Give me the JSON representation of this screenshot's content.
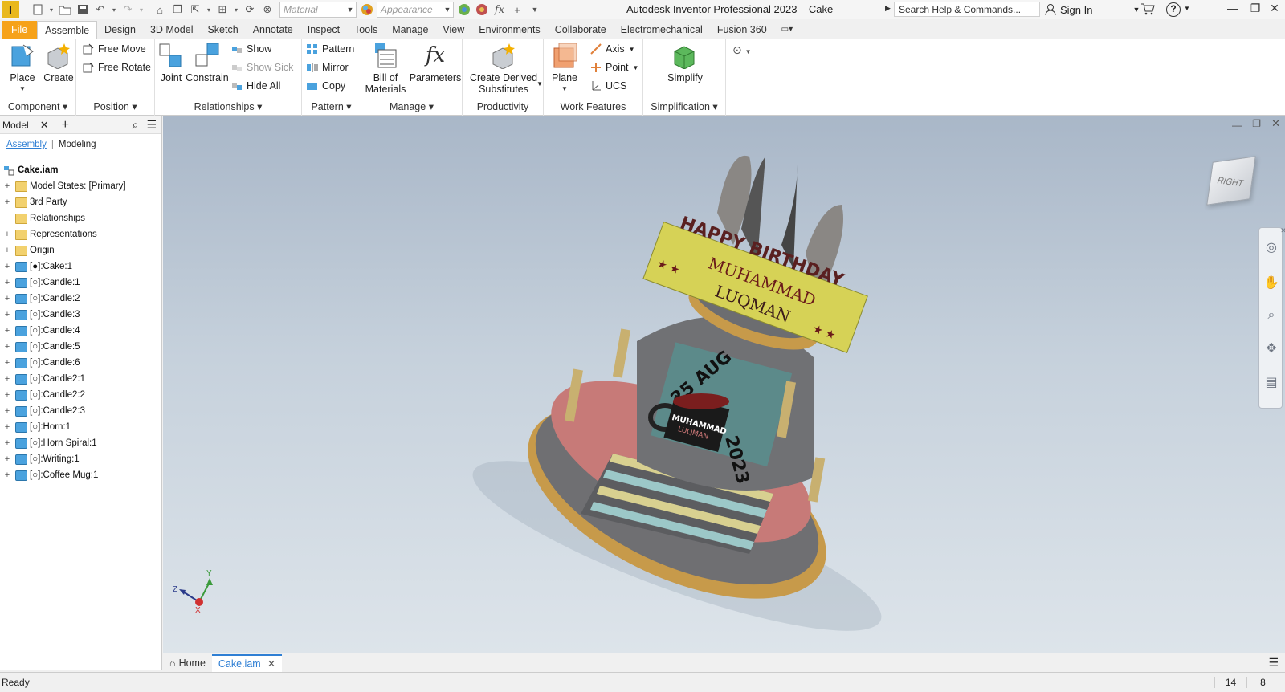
{
  "title_bar": {
    "app_title": "Autodesk Inventor Professional 2023",
    "document_name": "Cake",
    "material_placeholder": "Material",
    "appearance_placeholder": "Appearance",
    "search_placeholder": "Search Help & Commands...",
    "sign_in": "Sign In",
    "logo_letter": "I",
    "fx": "fx"
  },
  "tabs": [
    "File",
    "Assemble",
    "Design",
    "3D Model",
    "Sketch",
    "Annotate",
    "Inspect",
    "Tools",
    "Manage",
    "View",
    "Environments",
    "Collaborate",
    "Electromechanical",
    "Fusion 360"
  ],
  "active_tab": "Assemble",
  "ribbon": {
    "component": {
      "title": "Component",
      "place": "Place",
      "create": "Create"
    },
    "position": {
      "title": "Position",
      "free_move": "Free Move",
      "free_rotate": "Free Rotate"
    },
    "relationships": {
      "title": "Relationships",
      "joint": "Joint",
      "constrain": "Constrain",
      "show": "Show",
      "show_sick": "Show Sick",
      "hide_all": "Hide All"
    },
    "pattern": {
      "title": "Pattern",
      "pattern": "Pattern",
      "mirror": "Mirror",
      "copy": "Copy"
    },
    "manage": {
      "title": "Manage",
      "bom_line1": "Bill of",
      "bom_line2": "Materials",
      "parameters": "Parameters",
      "fx": "fx"
    },
    "productivity": {
      "title": "Productivity",
      "cds_line1": "Create Derived",
      "cds_line2": "Substitutes"
    },
    "work_features": {
      "title": "Work Features",
      "plane": "Plane",
      "axis": "Axis",
      "point": "Point",
      "ucs": "UCS"
    },
    "simplification": {
      "title": "Simplification",
      "simplify": "Simplify"
    }
  },
  "browser": {
    "title": "Model",
    "sub_assembly": "Assembly",
    "sub_modeling": "Modeling",
    "root": "Cake.iam",
    "nodes": [
      {
        "label": "Model States: [Primary]",
        "icon": "folder-icon",
        "expand": true
      },
      {
        "label": "3rd Party",
        "icon": "third-party-icon",
        "expand": true
      },
      {
        "label": "Relationships",
        "icon": "folder-icon",
        "expand": false
      },
      {
        "label": "Representations",
        "icon": "representations-icon",
        "expand": true
      },
      {
        "label": "Origin",
        "icon": "folder-icon",
        "expand": true
      },
      {
        "label": "[●]:Cake:1",
        "icon": "part-icon",
        "expand": true
      },
      {
        "label": "[○]:Candle:1",
        "icon": "part-icon",
        "expand": true
      },
      {
        "label": "[○]:Candle:2",
        "icon": "part-icon",
        "expand": true
      },
      {
        "label": "[○]:Candle:3",
        "icon": "part-icon",
        "expand": true
      },
      {
        "label": "[○]:Candle:4",
        "icon": "part-icon",
        "expand": true
      },
      {
        "label": "[○]:Candle:5",
        "icon": "part-icon",
        "expand": true
      },
      {
        "label": "[○]:Candle:6",
        "icon": "part-icon",
        "expand": true
      },
      {
        "label": "[○]:Candle2:1",
        "icon": "part-icon",
        "expand": true
      },
      {
        "label": "[○]:Candle2:2",
        "icon": "part-icon",
        "expand": true
      },
      {
        "label": "[○]:Candle2:3",
        "icon": "part-icon",
        "expand": true
      },
      {
        "label": "[○]:Horn:1",
        "icon": "part-icon",
        "expand": true
      },
      {
        "label": "[○]:Horn Spiral:1",
        "icon": "part-icon",
        "expand": true
      },
      {
        "label": "[○]:Writing:1",
        "icon": "part-icon",
        "expand": true
      },
      {
        "label": "[○]:Coffee Mug:1",
        "icon": "part-icon",
        "expand": true
      }
    ]
  },
  "model_text": {
    "banner_line1": "HAPPY BIRTHDAY",
    "banner_line2": "MUHAMMAD",
    "banner_line3": "LUQMAN",
    "date_left": "25 AUG",
    "date_right": "2023",
    "mug_line1": "MUHAMMAD",
    "mug_line2": "LUQMAN"
  },
  "viewcube_face": "RIGHT",
  "triad": {
    "x": "X",
    "y": "Y",
    "z": "Z"
  },
  "doc_tabs": {
    "home": "Home",
    "active": "Cake.iam"
  },
  "status": {
    "text": "Ready",
    "count1": "14",
    "count2": "8"
  },
  "colors": {
    "file_tab": "#f6a21a",
    "active_doc_tab": "#2f7fd4",
    "viewport_top": "#a9b7c8",
    "viewport_bottom": "#dde4ea"
  }
}
